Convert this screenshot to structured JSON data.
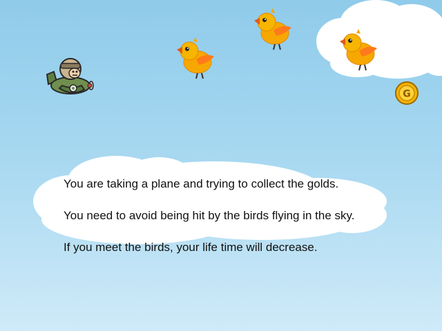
{
  "colors": {
    "sky_top": "#8fcbea",
    "sky_bottom": "#cfeaf8",
    "cloud": "#ffffff",
    "bird_body": "#f7a800",
    "bird_wing": "#ff7a1a",
    "coin": "#f5b400",
    "plane": "#6f8f4e"
  },
  "sprites": {
    "player": "green-biplane-pilot",
    "enemies": [
      "orange-bird",
      "orange-bird",
      "orange-bird"
    ],
    "pickup": "gold-coin"
  },
  "coin": {
    "label": "G"
  },
  "instructions": {
    "lines": [
      "You are taking a plane and trying to collect the golds.",
      "You need to avoid being hit by the birds flying in the sky.",
      "If you meet the birds, your life time will decrease."
    ]
  }
}
